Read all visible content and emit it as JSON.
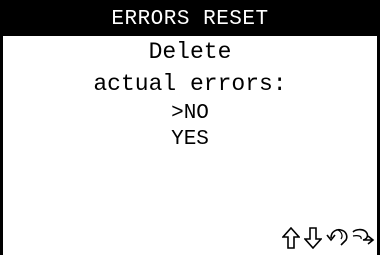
{
  "screen": {
    "title": "ERRORS RESET",
    "prompt_line1": "Delete",
    "prompt_line2": "actual errors:",
    "options": [
      {
        "label": ">NO",
        "selected": true
      },
      {
        "label": "YES",
        "selected": false
      }
    ]
  },
  "nav": {
    "icons": [
      "up-arrow-icon",
      "down-arrow-icon",
      "back-icon",
      "enter-icon"
    ]
  }
}
